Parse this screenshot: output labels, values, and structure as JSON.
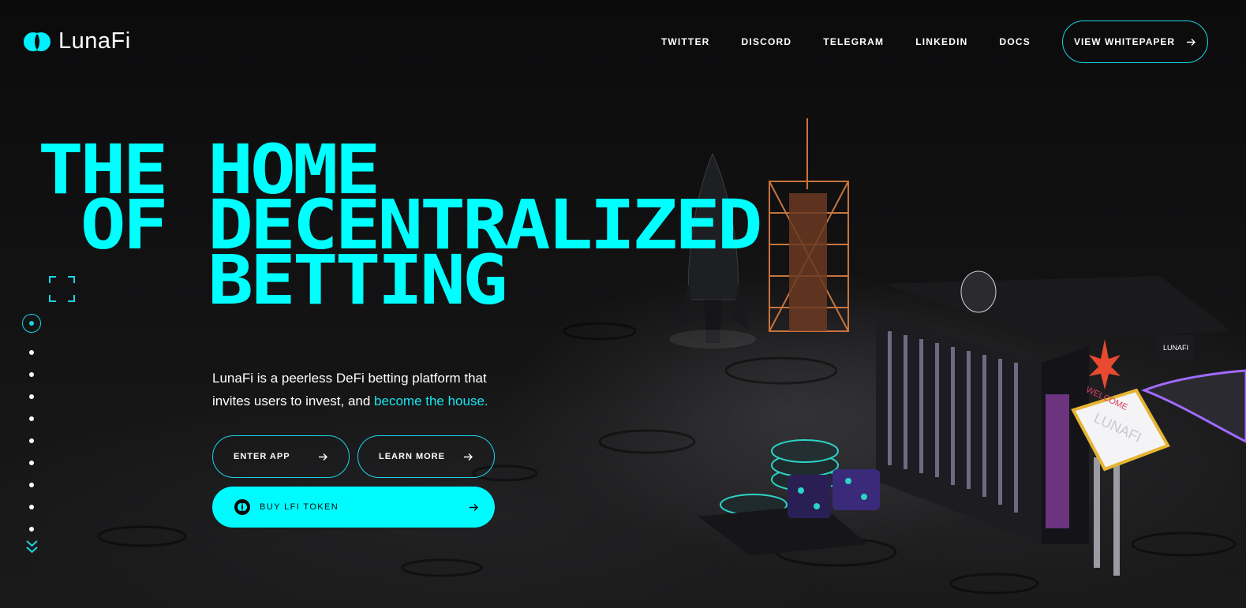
{
  "brand": {
    "name": "LunaFi"
  },
  "nav": {
    "links": [
      "TWITTER",
      "DISCORD",
      "TELEGRAM",
      "LINKEDIN",
      "DOCS"
    ],
    "whitepaper_label": "VIEW WHITEPAPER"
  },
  "hero": {
    "title_lines": [
      "THE HOME",
      " OF DECENTRALIZED",
      "    BETTING"
    ],
    "description_prefix": "LunaFi is a peerless DeFi betting platform that invites users to invest, and ",
    "description_highlight": "become the house.",
    "enter_label": "ENTER APP",
    "learn_label": "LEARN MORE",
    "buy_label": "BUY LFI TOKEN"
  },
  "scene": {
    "sign_top": "WELCOME",
    "sign_main": "LUNAFI",
    "building_sign": "LUNAFI"
  },
  "pager": {
    "count": 10,
    "active": 0
  },
  "colors": {
    "accent": "#00ffff",
    "background": "#0d0d0e",
    "button_fill": "#00fbff"
  }
}
